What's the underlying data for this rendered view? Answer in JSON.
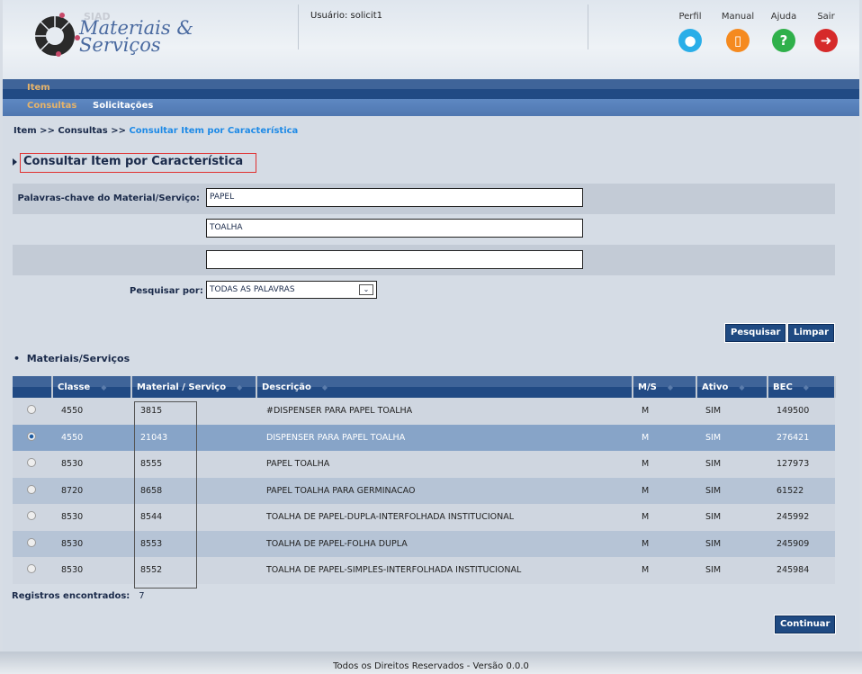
{
  "header": {
    "siad": "SIAD",
    "app_line1": "Materiais &",
    "app_line2": "Serviços",
    "user": "Usuário: solicit1",
    "tools": [
      {
        "label": "Perfil",
        "icon": "profile-icon",
        "color": "#2aaee8"
      },
      {
        "label": "Manual",
        "icon": "document-icon",
        "color": "#f58a1f"
      },
      {
        "label": "Ajuda",
        "icon": "help-icon",
        "color": "#2fb04a"
      },
      {
        "label": "Sair",
        "icon": "exit-arrow-icon",
        "color": "#d62a2a"
      }
    ]
  },
  "nav": {
    "main": "Item",
    "sub": [
      "Consultas",
      "Solicitações"
    ]
  },
  "breadcrumb": {
    "p1": "Item >> Consultas >> ",
    "current": "Consultar Item por Característica"
  },
  "title": "Consultar Item por Característica",
  "form": {
    "keywords_label": "Palavras-chave do Material/Serviço:",
    "kw1": "PAPEL",
    "kw2": "TOALHA",
    "kw3": "",
    "search_by_label": "Pesquisar por:",
    "search_by": "TODAS AS PALAVRAS",
    "search_btn": "Pesquisar",
    "clear_btn": "Limpar"
  },
  "section": "Materiais/Serviços",
  "table": {
    "headers": [
      "Classe",
      "Material / Serviço",
      "Descrição",
      "M/S",
      "Ativo",
      "BEC"
    ],
    "rows": [
      [
        "4550",
        "3815",
        "#DISPENSER PARA PAPEL TOALHA",
        "M",
        "SIM",
        "149500"
      ],
      [
        "4550",
        "21043",
        "DISPENSER PARA PAPEL TOALHA",
        "M",
        "SIM",
        "276421"
      ],
      [
        "8530",
        "8555",
        "PAPEL TOALHA",
        "M",
        "SIM",
        "127973"
      ],
      [
        "8720",
        "8658",
        "PAPEL TOALHA PARA GERMINACAO",
        "M",
        "SIM",
        "61522"
      ],
      [
        "8530",
        "8544",
        "TOALHA DE PAPEL-DUPLA-INTERFOLHADA INSTITUCIONAL",
        "M",
        "SIM",
        "245992"
      ],
      [
        "8530",
        "8553",
        "TOALHA DE PAPEL-FOLHA DUPLA",
        "M",
        "SIM",
        "245909"
      ],
      [
        "8530",
        "8552",
        "TOALHA DE PAPEL-SIMPLES-INTERFOLHADA INSTITUCIONAL",
        "M",
        "SIM",
        "245984"
      ]
    ],
    "selected_row": 1
  },
  "found_label": "Registros encontrados:",
  "found_count": "7",
  "continue_btn": "Continuar",
  "footer": "Todos os Direitos Reservados - Versão 0.0.0"
}
